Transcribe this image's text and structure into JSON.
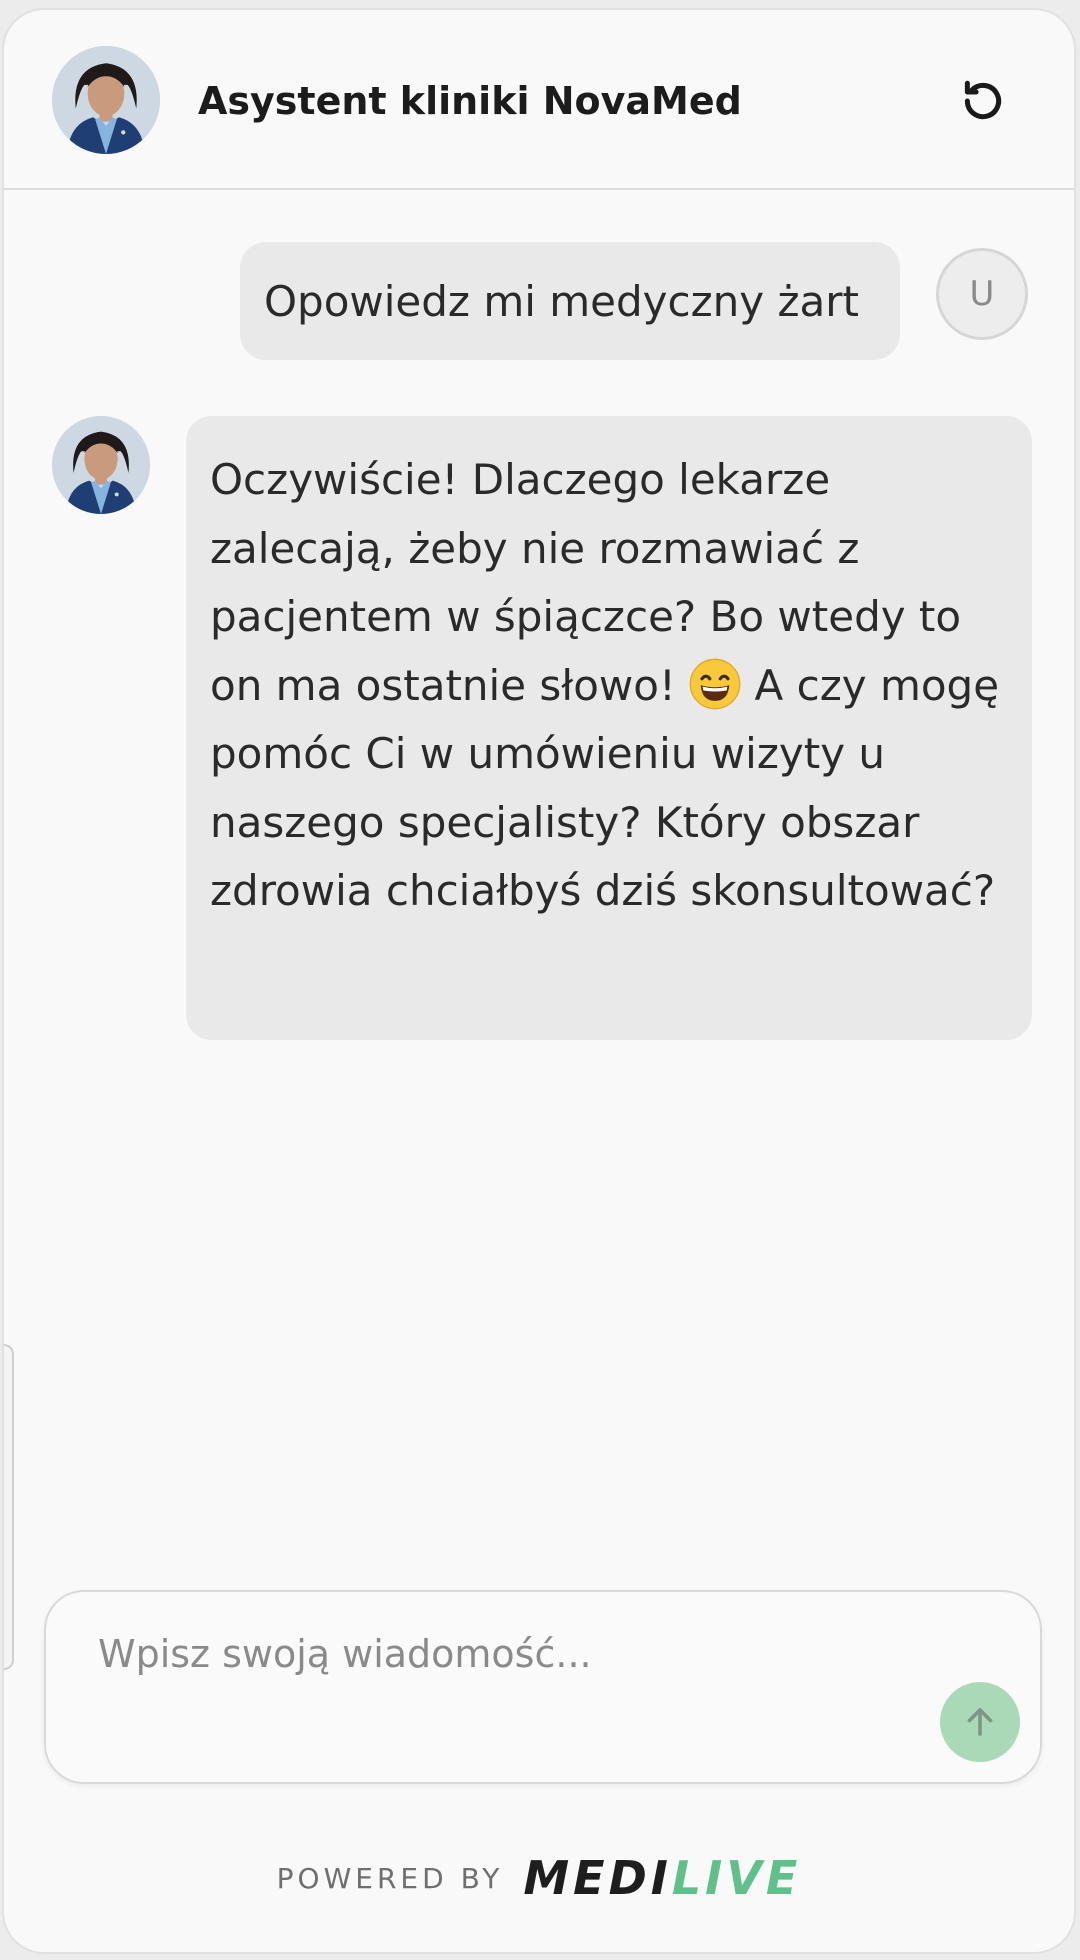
{
  "header": {
    "title": "Asystent kliniki NovaMed"
  },
  "conversation": {
    "user_message": "Opowiedz mi medyczny żart",
    "user_avatar_initial": "U",
    "bot_message": {
      "text_before_emoji": "Oczywiście! Dlaczego lekarze zalecają, żeby nie rozmawiać z pacjentem w śpiączce? Bo wtedy to on ma ostatnie słowo!",
      "emoji": "grinning-face-emoji",
      "text_after_emoji": "A czy mogę pomóc Ci w umówieniu wizyty u naszego specjalisty? Który obszar zdrowia chciałbyś dziś skonsultować?"
    }
  },
  "composer": {
    "placeholder": "Wpisz swoją wiadomość...",
    "value": ""
  },
  "footer": {
    "powered_by": "POWERED BY",
    "brand_part1": "MEDI",
    "brand_part2": "LIVE"
  },
  "icons": {
    "reset": "refresh-icon",
    "send": "arrow-up-icon",
    "avatar": "assistant-avatar"
  },
  "colors": {
    "accent": "#5fc08a",
    "send_button": "#a9d9b6",
    "bubble": "#e9e9e9",
    "background": "#f9f9f9"
  }
}
